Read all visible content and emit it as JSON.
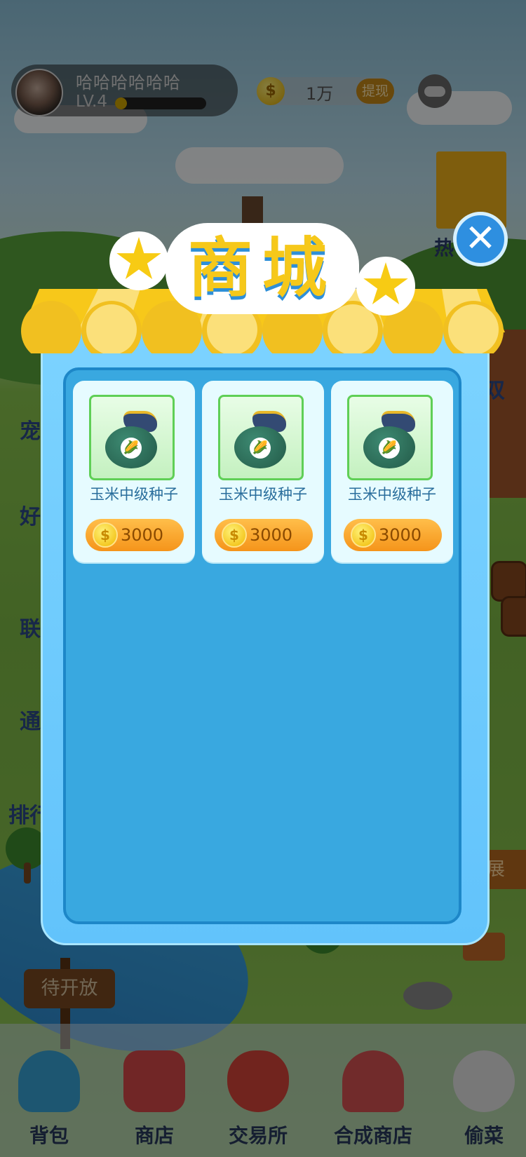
{
  "top_bar": {
    "player_name": "哈哈哈哈哈哈",
    "level": "LV.4",
    "xp_progress": 0.1,
    "coins": "1万",
    "withdraw_label": "提现",
    "coin_symbol": "$"
  },
  "side_labels": {
    "hot": "热",
    "pet": "宠",
    "friends": "好",
    "alliance": "联",
    "pass": "通",
    "rank": "排行",
    "right_edge": "双",
    "expand": "展"
  },
  "signpost": "待开放",
  "modal": {
    "title": "商城",
    "close_symbol": "✕",
    "products": [
      {
        "name": "玉米中级种子",
        "price": "3000"
      },
      {
        "name": "玉米中级种子",
        "price": "3000"
      },
      {
        "name": "玉米中级种子",
        "price": "3000"
      }
    ]
  },
  "bottom_nav": [
    {
      "label": "背包",
      "icon": "backpack-icon",
      "color": "#38a6d8"
    },
    {
      "label": "商店",
      "icon": "shop-icon",
      "color": "#d94a4a"
    },
    {
      "label": "交易所",
      "icon": "money-bag-icon",
      "color": "#d9453a"
    },
    {
      "label": "合成商店",
      "icon": "house-icon",
      "color": "#d95454"
    },
    {
      "label": "偷菜",
      "icon": "glove-icon",
      "color": "#e6e6e6"
    }
  ],
  "colors": {
    "modal_blue": "#39a8e0",
    "awning_yellow": "#f6c81a",
    "buy_orange": "#f5941a"
  }
}
